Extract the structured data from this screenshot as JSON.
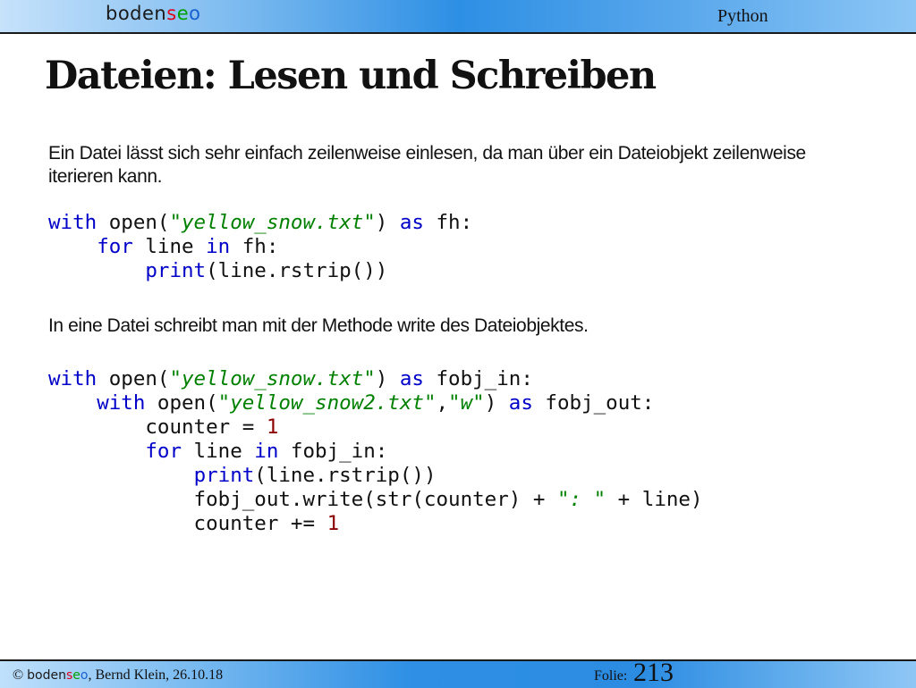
{
  "header": {
    "brand_parts": [
      "boden",
      "s",
      "e",
      "o"
    ],
    "section": "Python"
  },
  "title": "Dateien: Lesen und Schreiben",
  "intro_text": "Ein Datei lässt sich sehr einfach zeilenweise einlesen, da man über ein Dateiobjekt zeilenweise iterieren kann.",
  "code1": [
    [
      [
        "kw",
        "with"
      ],
      [
        "t",
        " open("
      ],
      [
        "stri",
        "\"yellow_snow.txt\""
      ],
      [
        "t",
        ") "
      ],
      [
        "kw",
        "as"
      ],
      [
        "t",
        " fh:"
      ]
    ],
    [
      [
        "t",
        "    "
      ],
      [
        "kw",
        "for"
      ],
      [
        "t",
        " line "
      ],
      [
        "kw",
        "in"
      ],
      [
        "t",
        " fh:"
      ]
    ],
    [
      [
        "t",
        "        "
      ],
      [
        "kw",
        "print"
      ],
      [
        "t",
        "(line.rstrip())"
      ]
    ]
  ],
  "write_text": "In eine Datei schreibt man mit der Methode write des Dateiobjektes.",
  "code2": [
    [
      [
        "kw",
        "with"
      ],
      [
        "t",
        " open("
      ],
      [
        "stri",
        "\"yellow_snow.txt\""
      ],
      [
        "t",
        ") "
      ],
      [
        "kw",
        "as"
      ],
      [
        "t",
        " fobj_in:"
      ]
    ],
    [
      [
        "t",
        "    "
      ],
      [
        "kw",
        "with"
      ],
      [
        "t",
        " open("
      ],
      [
        "stri",
        "\"yellow_snow2.txt\""
      ],
      [
        "t",
        ","
      ],
      [
        "stri",
        "\"w\""
      ],
      [
        "t",
        ") "
      ],
      [
        "kw",
        "as"
      ],
      [
        "t",
        " fobj_out:"
      ]
    ],
    [
      [
        "t",
        "        counter = "
      ],
      [
        "num",
        "1"
      ]
    ],
    [
      [
        "t",
        "        "
      ],
      [
        "kw",
        "for"
      ],
      [
        "t",
        " line "
      ],
      [
        "kw",
        "in"
      ],
      [
        "t",
        " fobj_in:"
      ]
    ],
    [
      [
        "t",
        "            "
      ],
      [
        "kw",
        "print"
      ],
      [
        "t",
        "(line.rstrip())"
      ]
    ],
    [
      [
        "t",
        "            fobj_out.write(str(counter) + "
      ],
      [
        "stri",
        "\": \""
      ],
      [
        "t",
        " + line)"
      ]
    ],
    [
      [
        "t",
        "            counter += "
      ],
      [
        "num",
        "1"
      ]
    ]
  ],
  "footer": {
    "copyright_prefix": "© ",
    "brand_parts": [
      "boden",
      "s",
      "e",
      "o"
    ],
    "copyright_suffix": ", Bernd Klein, 26.10.18",
    "folie_label": "Folie:",
    "folie_number": "213"
  }
}
